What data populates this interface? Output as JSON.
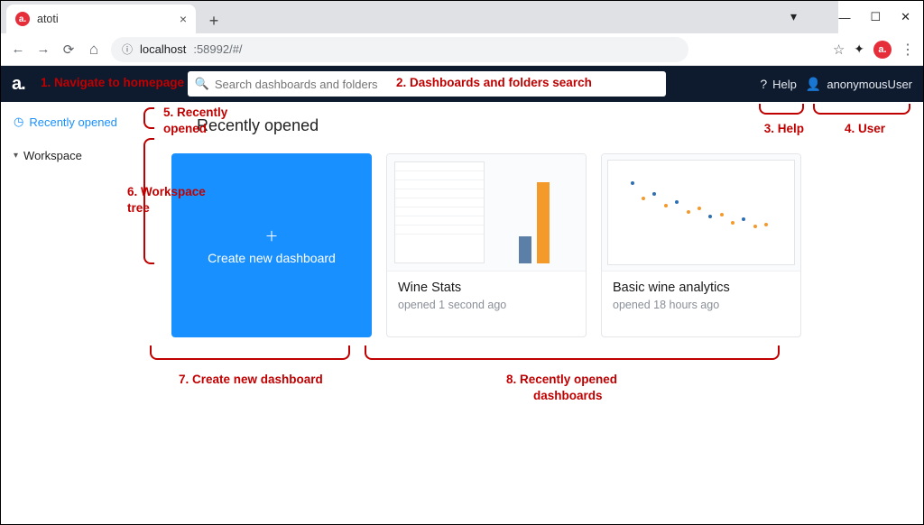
{
  "browser": {
    "tab_title": "atoti",
    "url_host": "localhost",
    "url_port_path": ":58992/#/"
  },
  "app_header": {
    "logo_text": "a.",
    "search_placeholder": "Search dashboards and folders",
    "help_label": "Help",
    "user_label": "anonymousUser"
  },
  "sidebar": {
    "recent_label": "Recently opened",
    "workspace_label": "Workspace"
  },
  "main": {
    "heading": "Recently opened",
    "create_label": "Create new dashboard",
    "dashboards": [
      {
        "title": "Wine Stats",
        "subtitle": "opened 1 second ago"
      },
      {
        "title": "Basic wine analytics",
        "subtitle": "opened 18 hours ago"
      }
    ]
  },
  "annotations": {
    "a1": "1. Navigate to homepage",
    "a2": "2. Dashboards and folders search",
    "a3": "3. Help",
    "a4": "4. User",
    "a5a": "5. Recently",
    "a5b": "opened",
    "a6a": "6. Workspace",
    "a6b": "tree",
    "a7": "7. Create new dashboard",
    "a8a": "8. Recently opened",
    "a8b": "dashboards"
  }
}
